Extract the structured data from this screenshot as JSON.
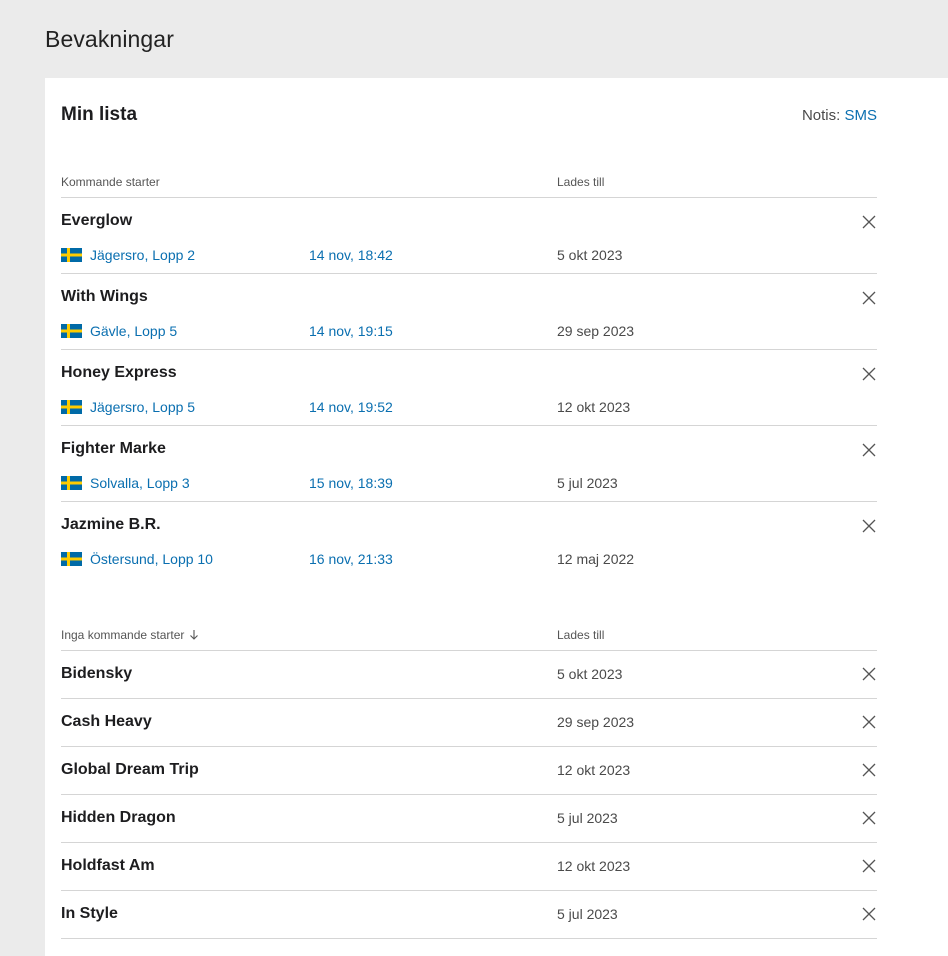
{
  "page": {
    "title": "Bevakningar"
  },
  "card": {
    "title": "Min lista",
    "notis_label": "Notis:",
    "notis_value": "SMS"
  },
  "upcoming": {
    "col1": "Kommande starter",
    "col2": "Lades till",
    "rows": [
      {
        "name": "Everglow",
        "track": "Jägersro, Lopp 2",
        "time": "14 nov, 18:42",
        "added": "5 okt 2023"
      },
      {
        "name": "With Wings",
        "track": "Gävle, Lopp 5",
        "time": "14 nov, 19:15",
        "added": "29 sep 2023"
      },
      {
        "name": "Honey Express",
        "track": "Jägersro, Lopp 5",
        "time": "14 nov, 19:52",
        "added": "12 okt 2023"
      },
      {
        "name": "Fighter Marke",
        "track": "Solvalla, Lopp 3",
        "time": "15 nov, 18:39",
        "added": "5 jul 2023"
      },
      {
        "name": "Jazmine B.R.",
        "track": "Östersund, Lopp 10",
        "time": "16 nov, 21:33",
        "added": "12 maj 2022"
      }
    ]
  },
  "no_upcoming": {
    "col1": "Inga kommande starter",
    "col2": "Lades till",
    "rows": [
      {
        "name": "Bidensky",
        "added": "5 okt 2023"
      },
      {
        "name": "Cash Heavy",
        "added": "29 sep 2023"
      },
      {
        "name": "Global Dream Trip",
        "added": "12 okt 2023"
      },
      {
        "name": "Hidden Dragon",
        "added": "5 jul 2023"
      },
      {
        "name": "Holdfast Am",
        "added": "12 okt 2023"
      },
      {
        "name": "In Style",
        "added": "5 jul 2023"
      }
    ]
  },
  "icons": {
    "flag": "sweden-flag-icon",
    "remove": "close-icon",
    "sort": "arrow-down-icon"
  },
  "colors": {
    "link": "#0a6fb0",
    "background": "#ebebeb",
    "card": "#ffffff",
    "flag_blue": "#006aa7",
    "flag_yellow": "#fecc00"
  }
}
